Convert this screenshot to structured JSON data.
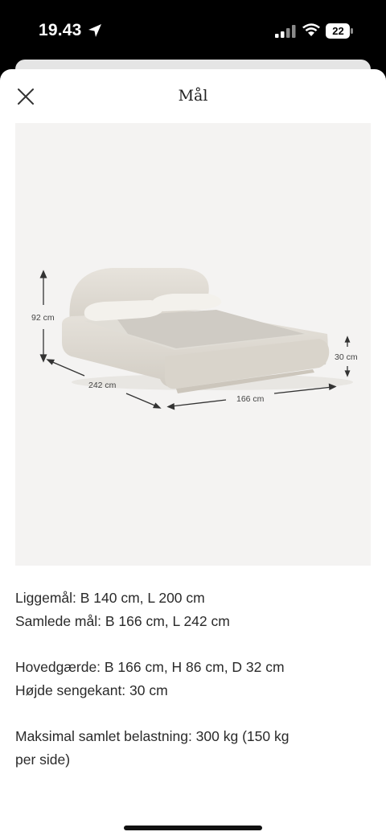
{
  "status_bar": {
    "time": "19.43",
    "battery": "22"
  },
  "header": {
    "title": "Mål"
  },
  "image": {
    "labels": {
      "height": "92 cm",
      "length": "242 cm",
      "width": "166 cm",
      "edge_height": "30 cm"
    }
  },
  "details": {
    "groups": [
      [
        "Liggemål: B 140 cm, L 200 cm",
        "Samlede mål: B 166 cm, L 242 cm"
      ],
      [
        "Hovedgærde: B 166 cm, H 86 cm, D 32 cm",
        "Højde sengekant: 30 cm"
      ],
      [
        "Maksimal samlet belastning: 300 kg (150 kg",
        "per side)"
      ]
    ]
  }
}
